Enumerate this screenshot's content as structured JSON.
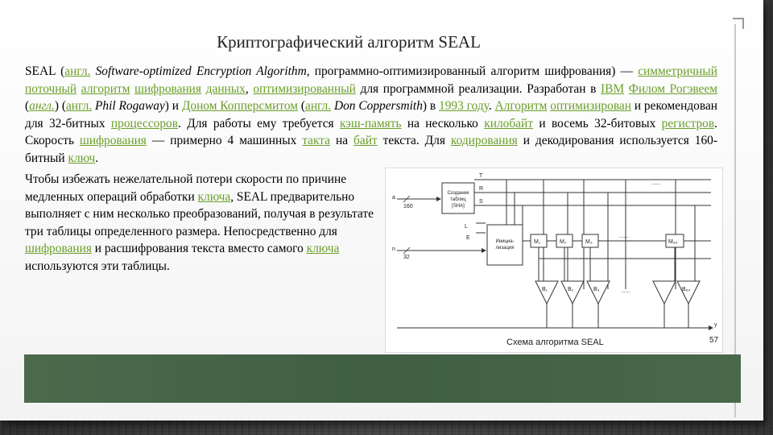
{
  "slide": {
    "title": "Криптографический алгоритм SEAL",
    "para1": [
      {
        "t": "SEAL ("
      },
      {
        "t": "англ.",
        "link": true
      },
      {
        "t": " "
      },
      {
        "t": "Software-optimized Encryption Algorithm",
        "i": true
      },
      {
        "t": ", программно-оптимизированный алгоритм шифрования) — "
      },
      {
        "t": "симметричный",
        "link": true
      },
      {
        "t": " "
      },
      {
        "t": "поточный",
        "link": true
      },
      {
        "t": " "
      },
      {
        "t": "алгоритм",
        "link": true
      },
      {
        "t": " "
      },
      {
        "t": "шифрования",
        "link": true
      },
      {
        "t": " "
      },
      {
        "t": "данных",
        "link": true
      },
      {
        "t": ", "
      },
      {
        "t": "оптимизированный",
        "link": true
      },
      {
        "t": " для программной реализации. Разработан в "
      },
      {
        "t": "IBM",
        "link": true
      },
      {
        "t": " "
      },
      {
        "t": "Филом Рогэвеем",
        "link": true
      },
      {
        "t": " ("
      },
      {
        "t": "англ.",
        "link": true,
        "i": true
      },
      {
        "t": ") ("
      },
      {
        "t": "англ.",
        "link": true
      },
      {
        "t": " "
      },
      {
        "t": "Phil Rogaway",
        "i": true
      },
      {
        "t": ") и "
      },
      {
        "t": "Доном Копперсмитом",
        "link": true
      },
      {
        "t": " ("
      },
      {
        "t": "англ.",
        "link": true
      },
      {
        "t": " "
      },
      {
        "t": "Don Coppersmith",
        "i": true
      },
      {
        "t": ") в "
      },
      {
        "t": "1993 году",
        "link": true
      },
      {
        "t": ". "
      },
      {
        "t": "Алгоритм",
        "link": true
      },
      {
        "t": " "
      },
      {
        "t": "оптимизирован",
        "link": true
      },
      {
        "t": " и рекомендован для 32-битных "
      },
      {
        "t": "процессоров",
        "link": true
      },
      {
        "t": ". Для работы ему требуется "
      },
      {
        "t": "кэш-память",
        "link": true
      },
      {
        "t": " на несколько "
      },
      {
        "t": "килобайт",
        "link": true
      },
      {
        "t": " и восемь 32-битовых "
      },
      {
        "t": "регистров",
        "link": true
      },
      {
        "t": ". Скорость "
      },
      {
        "t": "шифрования",
        "link": true
      },
      {
        "t": " — примерно 4 машинных "
      },
      {
        "t": "такта",
        "link": true
      },
      {
        "t": " на "
      },
      {
        "t": "байт",
        "link": true
      },
      {
        "t": " текста. Для "
      },
      {
        "t": "кодирования",
        "link": true
      },
      {
        "t": " и декодирования используется 160-битный "
      },
      {
        "t": "ключ",
        "link": true
      },
      {
        "t": "."
      }
    ],
    "para2": [
      {
        "t": "Чтобы избежать нежелательной потери скорости по причине медленных операций обработки "
      },
      {
        "t": "ключа",
        "link": true
      },
      {
        "t": ", SEAL предварительно выполняет с ним несколько преобразований, получая в результате три таблицы определенного размера. Непосредственно для "
      },
      {
        "t": "шифрования",
        "link": true
      },
      {
        "t": " и расшифрования текста вместо самого "
      },
      {
        "t": "ключа",
        "link": true
      },
      {
        "t": " используются эти таблицы."
      }
    ],
    "colors": {
      "link": "#6a9f2a",
      "footer": "#446347"
    }
  },
  "diagram": {
    "caption": "Схема алгоритма SEAL",
    "page_num": "57",
    "box1_label": "Создание таблиц [SHA]",
    "box2_label": "Инициа-лизация",
    "in_a": "a",
    "in_a_bits": "160",
    "in_n": "n",
    "in_n_bits": "32",
    "sig_T": "T",
    "sig_R": "R",
    "sig_S": "S",
    "sig_L": "L",
    "sig_E": "E",
    "regs": [
      "M₁",
      "M₂",
      "M₃",
      "M₆₄"
    ],
    "outs": [
      "B₁",
      "B₂",
      "B₃",
      "B₆₄"
    ],
    "y_label": "y",
    "dots": "......"
  }
}
